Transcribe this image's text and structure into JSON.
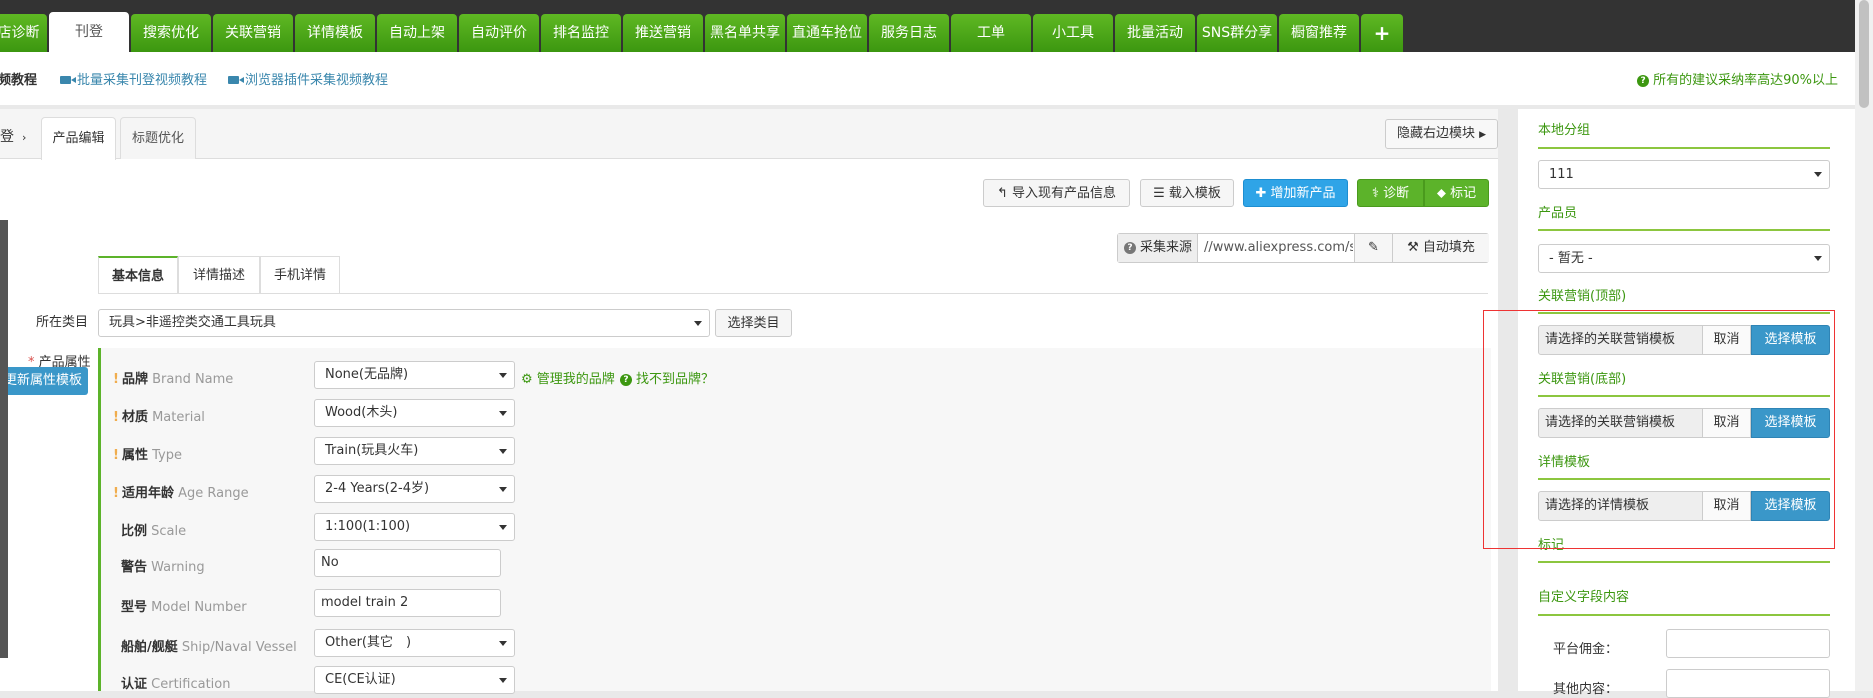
{
  "nav": {
    "tabs": [
      {
        "label": "店诊断"
      },
      {
        "label": "刊登"
      },
      {
        "label": "搜索优化"
      },
      {
        "label": "关联营销"
      },
      {
        "label": "详情模板"
      },
      {
        "label": "自动上架"
      },
      {
        "label": "自动评价"
      },
      {
        "label": "排名监控"
      },
      {
        "label": "推送营销"
      },
      {
        "label": "黑名单共享"
      },
      {
        "label": "直通车抢位"
      },
      {
        "label": "服务日志"
      },
      {
        "label": "工单"
      },
      {
        "label": "小工具"
      },
      {
        "label": "批量活动"
      },
      {
        "label": "SNS群分享"
      },
      {
        "label": "橱窗推荐"
      },
      {
        "label": "+"
      }
    ],
    "active": "刊登",
    "colors": {
      "tab_green": "#4aa717",
      "dark_bg": "#333333"
    }
  },
  "tutorials": {
    "first": "频教程",
    "links": [
      "批量采集刊登视频教程",
      "浏览器插件采集视频教程"
    ],
    "tip": "所有的建议采纳率高达90%以上"
  },
  "page_tabs": {
    "breadcrumb": "登",
    "tabs": [
      "产品编辑",
      "标题优化"
    ],
    "hide_right": "隐藏右边模块"
  },
  "toolbar": {
    "import": "导入现有产品信息",
    "load_template": "载入模板",
    "add_product": "增加新产品",
    "diagnose": "诊断",
    "mark": "标记"
  },
  "source": {
    "label": "采集来源",
    "value": "//www.aliexpress.com/store",
    "autofill": "自动填充"
  },
  "sub_tabs": [
    "基本信息",
    "详情描述",
    "手机详情"
  ],
  "category": {
    "label": "所在类目",
    "value": "玩具>非遥控类交通工具玩具",
    "button": "选择类目"
  },
  "attributes": {
    "label": "产品属性",
    "update_button": "更新属性模板",
    "manage_brand": "管理我的品牌",
    "no_brand": "找不到品牌？",
    "rows": [
      {
        "cn": "品牌",
        "en": "Brand Name",
        "required": true,
        "value": "None(无品牌)",
        "kind": "select"
      },
      {
        "cn": "材质",
        "en": "Material",
        "required": true,
        "value": "Wood(木头)",
        "kind": "select"
      },
      {
        "cn": "属性",
        "en": "Type",
        "required": true,
        "value": "Train(玩具火车)",
        "kind": "select"
      },
      {
        "cn": "适用年龄",
        "en": "Age Range",
        "required": true,
        "value": "2-4 Years(2-4岁)",
        "kind": "select"
      },
      {
        "cn": "比例",
        "en": "Scale",
        "required": false,
        "value": "1:100(1:100)",
        "kind": "select"
      },
      {
        "cn": "警告",
        "en": "Warning",
        "required": false,
        "value": "No",
        "kind": "input"
      },
      {
        "cn": "型号",
        "en": "Model Number",
        "required": false,
        "value": "model train 2",
        "kind": "input"
      },
      {
        "cn": "船舶/舰艇",
        "en": "Ship/Naval Vessel",
        "required": false,
        "value": "Other(其它　)",
        "kind": "select"
      },
      {
        "cn": "认证",
        "en": "Certification",
        "required": false,
        "value": "CE(CE认证)",
        "kind": "select"
      }
    ]
  },
  "right_panel": {
    "local_group_label": "本地分组",
    "local_group_value": "111",
    "member_label": "产品员",
    "member_value": "- 暂无 -",
    "related_top_label": "关联营销(顶部)",
    "related_top_placeholder": "请选择的关联营销模板",
    "related_bottom_label": "关联营销(底部)",
    "related_bottom_placeholder": "请选择的关联营销模板",
    "detail_tpl_label": "详情模板",
    "detail_tpl_placeholder": "请选择的详情模板",
    "cancel": "取消",
    "select_tpl": "选择模板",
    "mark_label": "标记",
    "custom_label": "自定义字段内容",
    "commission_label": "平台佣金：",
    "other_label": "其他内容："
  }
}
